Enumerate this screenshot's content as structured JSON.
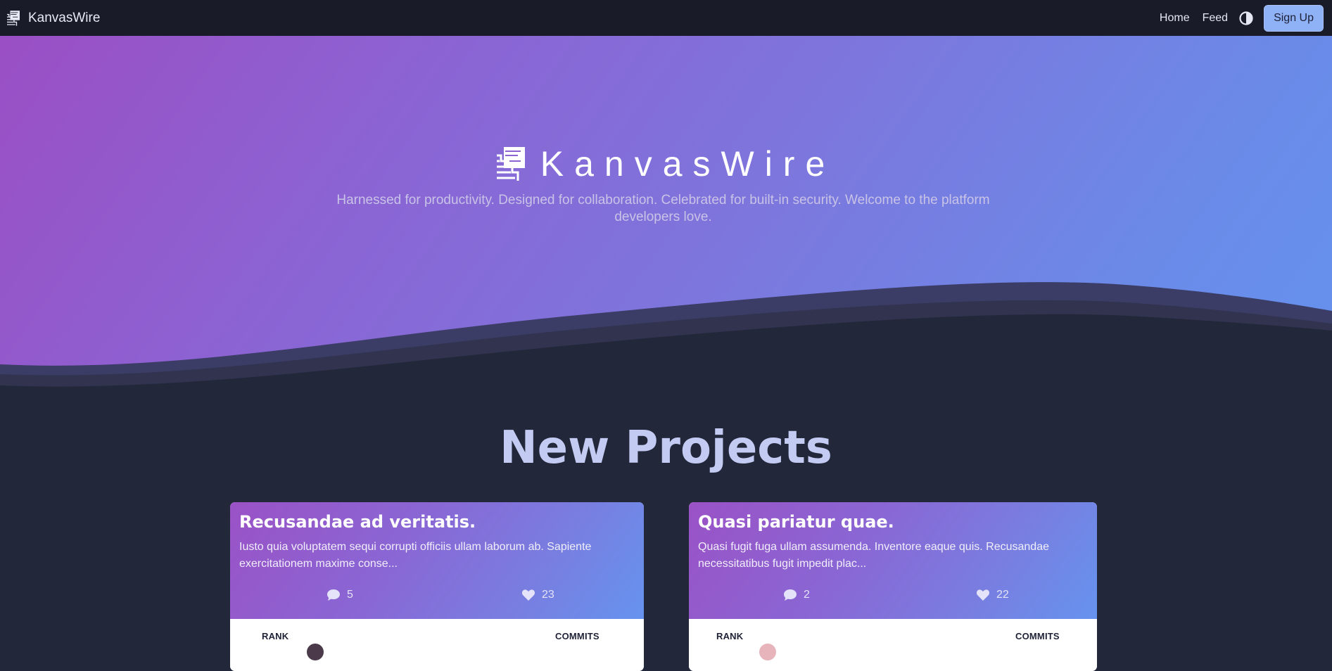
{
  "nav": {
    "brand": "KanvasWire",
    "links": [
      "Home",
      "Feed"
    ],
    "theme_toggle_icon": "contrast-icon",
    "signup_label": "Sign Up"
  },
  "hero": {
    "title": "KanvasWire",
    "tagline": "Harnessed for productivity. Designed for collaboration. Celebrated for built-in security. Welcome to the platform developers love."
  },
  "section": {
    "title": "New Projects"
  },
  "projects": [
    {
      "title": "Recusandae ad veritatis.",
      "description": "Iusto quia voluptatem sequi corrupti officiis ullam laborum ab. Sapiente exercitationem maxime conse...",
      "comments": "5",
      "likes": "23",
      "col_rank": "RANK",
      "col_commits": "COMMITS"
    },
    {
      "title": "Quasi pariatur quae.",
      "description": "Quasi fugit fuga ullam assumenda. Inventore eaque quis. Recusandae necessitatibus fugit impedit plac...",
      "comments": "2",
      "likes": "22",
      "col_rank": "RANK",
      "col_commits": "COMMITS"
    }
  ],
  "colors": {
    "navbar": "#191b29",
    "page_bg": "#23273a",
    "accent": "#8fb1f5",
    "heading": "#c3cbf3",
    "gradient_start": "#9a4fc4",
    "gradient_end": "#6592ee"
  }
}
